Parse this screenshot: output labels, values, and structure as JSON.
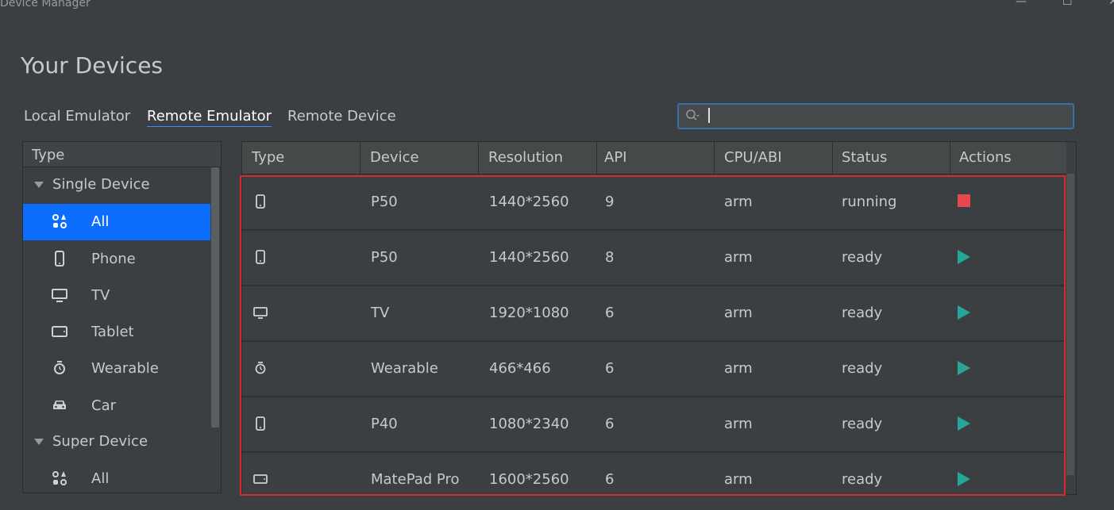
{
  "window": {
    "title": "Device Manager",
    "minimize_glyph": "—",
    "maximize_glyph": "☐",
    "close_glyph": "✕"
  },
  "page": {
    "title": "Your Devices"
  },
  "tabs": [
    {
      "label": "Local Emulator",
      "active": false
    },
    {
      "label": "Remote Emulator",
      "active": true
    },
    {
      "label": "Remote Device",
      "active": false
    }
  ],
  "search": {
    "value": "",
    "placeholder": ""
  },
  "sidebar": {
    "header": "Type",
    "groups": [
      {
        "label": "Single Device",
        "items": [
          {
            "label": "All",
            "icon": "grid-icon",
            "selected": true
          },
          {
            "label": "Phone",
            "icon": "phone-icon"
          },
          {
            "label": "TV",
            "icon": "tv-icon"
          },
          {
            "label": "Tablet",
            "icon": "tablet-icon"
          },
          {
            "label": "Wearable",
            "icon": "watch-icon"
          },
          {
            "label": "Car",
            "icon": "car-icon"
          }
        ]
      },
      {
        "label": "Super Device",
        "items": [
          {
            "label": "All",
            "icon": "grid-icon"
          }
        ]
      }
    ]
  },
  "table": {
    "columns": [
      "Type",
      "Device",
      "Resolution",
      "API",
      "CPU/ABI",
      "Status",
      "Actions"
    ],
    "rows": [
      {
        "type_icon": "phone-icon",
        "device": "P50",
        "resolution": "1440*2560",
        "api": "9",
        "cpu": "arm",
        "status": "running",
        "action": "stop"
      },
      {
        "type_icon": "phone-icon",
        "device": "P50",
        "resolution": "1440*2560",
        "api": "8",
        "cpu": "arm",
        "status": "ready",
        "action": "play"
      },
      {
        "type_icon": "tv-icon",
        "device": "TV",
        "resolution": "1920*1080",
        "api": "6",
        "cpu": "arm",
        "status": "ready",
        "action": "play"
      },
      {
        "type_icon": "watch-icon",
        "device": "Wearable",
        "resolution": "466*466",
        "api": "6",
        "cpu": "arm",
        "status": "ready",
        "action": "play"
      },
      {
        "type_icon": "phone-icon",
        "device": "P40",
        "resolution": "1080*2340",
        "api": "6",
        "cpu": "arm",
        "status": "ready",
        "action": "play"
      },
      {
        "type_icon": "tablet-icon",
        "device": "MatePad Pro",
        "resolution": "1600*2560",
        "api": "6",
        "cpu": "arm",
        "status": "ready",
        "action": "play"
      }
    ]
  },
  "colors": {
    "accent": "#0d6efd",
    "stop": "#e5484d",
    "play": "#26a69a",
    "highlight": "#d9282e"
  }
}
